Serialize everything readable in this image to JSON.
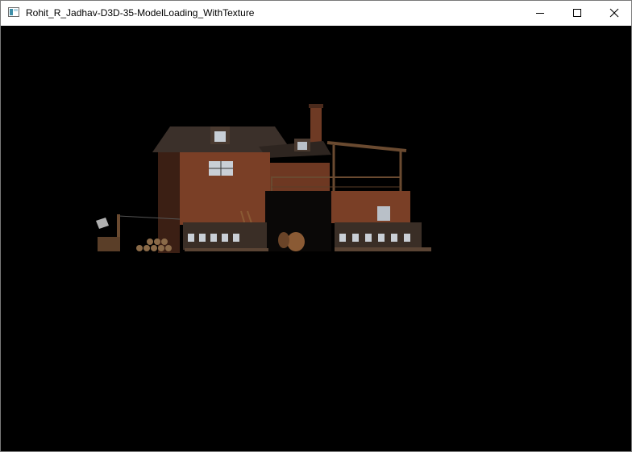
{
  "window": {
    "title": "Rohit_R_Jadhav-D3D-35-ModelLoading_WithTexture",
    "controls": {
      "minimize_icon": "minimize-icon",
      "maximize_icon": "maximize-icon",
      "close_icon": "close-icon"
    },
    "background_color": "#000000",
    "titlebar_color": "#ffffff"
  },
  "scene": {
    "model": "textured-house-model",
    "palette": {
      "brick": "#7a3f26",
      "roof": "#3b302a",
      "wood": "#6a4a30",
      "window": "#c9cfd6"
    }
  }
}
